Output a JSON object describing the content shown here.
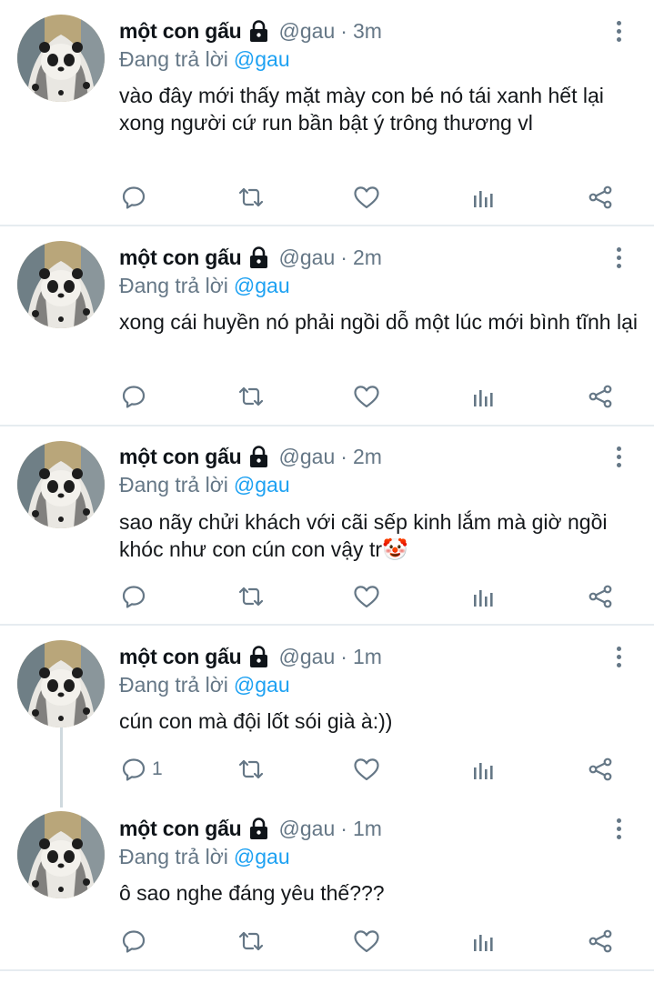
{
  "tweets": [
    {
      "name": "một con gấu",
      "handle": "@gau",
      "sep": "·",
      "time": "3m",
      "reply_prefix": "Đang trả lời",
      "reply_to": "@gau",
      "text": "vào đây mới thấy mặt mày con bé nó tái xanh hết lại xong người cứ run bần bật ý trông thương vl",
      "reply_count": ""
    },
    {
      "name": "một con gấu",
      "handle": "@gau",
      "sep": "·",
      "time": "2m",
      "reply_prefix": "Đang trả lời",
      "reply_to": "@gau",
      "text": "xong cái huyền nó phải ngồi dỗ một lúc mới bình tĩnh lại",
      "reply_count": ""
    },
    {
      "name": "một con gấu",
      "handle": "@gau",
      "sep": "·",
      "time": "2m",
      "reply_prefix": "Đang trả lời",
      "reply_to": "@gau",
      "text": "sao nãy chửi khách với cãi sếp kinh lắm mà giờ ngồi khóc như con cún con vậy tr🤡",
      "reply_count": ""
    },
    {
      "name": "một con gấu",
      "handle": "@gau",
      "sep": "·",
      "time": "1m",
      "reply_prefix": "Đang trả lời",
      "reply_to": "@gau",
      "text": "cún con mà đội lốt sói già à:))",
      "reply_count": "1"
    },
    {
      "name": "một con gấu",
      "handle": "@gau",
      "sep": "·",
      "time": "1m",
      "reply_prefix": "Đang trả lời",
      "reply_to": "@gau",
      "text": "ô sao nghe đáng yêu thế???",
      "reply_count": ""
    }
  ],
  "icons": {
    "lock": "lock-icon",
    "more": "more-vertical-icon",
    "reply": "reply-icon",
    "retweet": "retweet-icon",
    "like": "heart-icon",
    "stats": "stats-icon",
    "share": "share-icon"
  },
  "colors": {
    "text": "#14171a",
    "muted": "#657786",
    "link": "#1da1f2",
    "divider": "#e6ecf0",
    "thread_line": "#cfd9de"
  }
}
